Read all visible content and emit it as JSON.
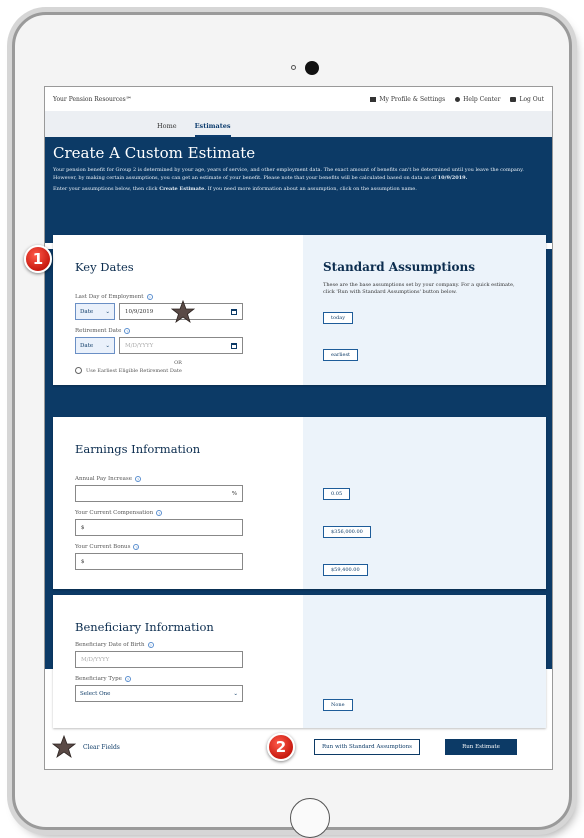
{
  "topbar": {
    "brand": "Your Pension Resources℠",
    "profile": "My Profile & Settings",
    "help": "Help Center",
    "logout": "Log Out"
  },
  "nav": {
    "home": "Home",
    "estimates": "Estimates"
  },
  "hero": {
    "title": "Create A Custom Estimate",
    "para1": "Your pension benefit for Group 2 is determined by your age, years of service, and other employment data. The exact amount of benefits can't be determined until you leave the company. However, by making certain assumptions, you can get an estimate of your benefit. Please note that your benefits will be calculated based on data as of",
    "para1_date": "10/9/2019.",
    "para2_a": "Enter your assumptions below, then click",
    "para2_bold": "Create Estimate.",
    "para2_b": "If you need more information about an assumption, click on the assumption name."
  },
  "key_dates": {
    "title": "Key Dates",
    "last_day_label": "Last Day of Employment",
    "last_day_type": "Date",
    "last_day_value": "10/9/2019",
    "retirement_label": "Retirement Date",
    "retirement_type": "Date",
    "retirement_placeholder": "M/D/YYYY",
    "or_text": "OR",
    "earliest_option": "Use Earliest Eligible Retirement Date"
  },
  "standard": {
    "title": "Standard Assumptions",
    "desc": "These are the base assumptions set by your company. For a quick estimate, click 'Run with Standard Assumptions' button below.",
    "last_day_value": "today",
    "retirement_value": "earliest"
  },
  "earnings": {
    "title": "Earnings Information",
    "pay_increase_label": "Annual Pay Increase",
    "pay_increase_suffix": "%",
    "compensation_label": "Your Current Compensation",
    "compensation_prefix": "$",
    "bonus_label": "Your Current Bonus",
    "bonus_prefix": "$",
    "std_pay_increase": "0.05",
    "std_compensation": "$356,000.00",
    "std_bonus": "$59,400.00"
  },
  "beneficiary": {
    "title": "Beneficiary Information",
    "dob_label": "Beneficiary Date of Birth",
    "dob_placeholder": "M/D/YYYY",
    "type_label": "Beneficiary Type",
    "type_value": "Select One",
    "std_value": "None"
  },
  "footer": {
    "clear": "Clear Fields",
    "run_standard": "Run with Standard Assumptions",
    "run_estimate": "Run Estimate"
  },
  "markers": {
    "one": "1",
    "two": "2"
  },
  "colors": {
    "navy": "#0c3a66",
    "marker_red": "#d0281a",
    "panel_light": "#ecf3fa"
  }
}
